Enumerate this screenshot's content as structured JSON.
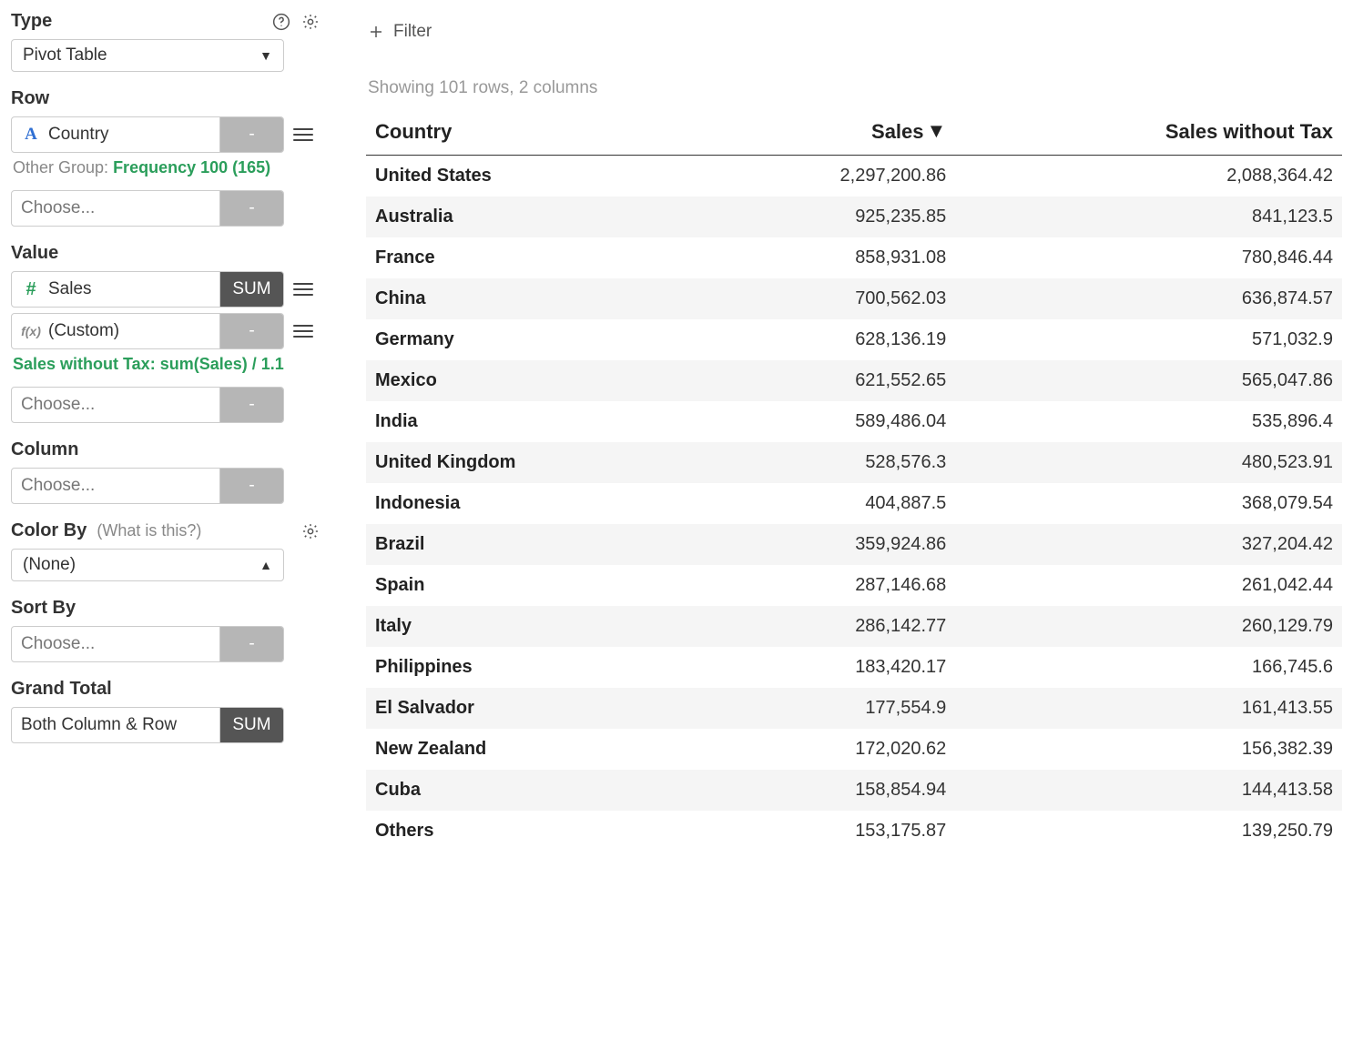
{
  "sidebar": {
    "type": {
      "label": "Type",
      "value": "Pivot Table"
    },
    "row": {
      "label": "Row",
      "field": "Country",
      "field_btn": "-",
      "subtext_grey": "Other Group:",
      "subtext_green": "Frequency 100 (165)",
      "choose": "Choose...",
      "choose_btn": "-"
    },
    "value": {
      "label": "Value",
      "field1": "Sales",
      "field1_btn": "SUM",
      "field2": "(Custom)",
      "field2_btn": "-",
      "formula": "Sales without Tax: sum(Sales) / 1.1",
      "choose": "Choose...",
      "choose_btn": "-"
    },
    "column": {
      "label": "Column",
      "choose": "Choose...",
      "choose_btn": "-"
    },
    "colorby": {
      "label": "Color By",
      "hint": "(What is this?)",
      "value": "(None)"
    },
    "sortby": {
      "label": "Sort By",
      "choose": "Choose...",
      "choose_btn": "-"
    },
    "grandtotal": {
      "label": "Grand Total",
      "value": "Both Column & Row",
      "btn": "SUM"
    }
  },
  "main": {
    "filter_label": "Filter",
    "status": "Showing 101 rows, 2 columns",
    "headers": {
      "country": "Country",
      "sales": "Sales",
      "sales_no_tax": "Sales without Tax"
    },
    "rows": [
      {
        "country": "United States",
        "sales": "2,297,200.86",
        "sales_no_tax": "2,088,364.42"
      },
      {
        "country": "Australia",
        "sales": "925,235.85",
        "sales_no_tax": "841,123.5"
      },
      {
        "country": "France",
        "sales": "858,931.08",
        "sales_no_tax": "780,846.44"
      },
      {
        "country": "China",
        "sales": "700,562.03",
        "sales_no_tax": "636,874.57"
      },
      {
        "country": "Germany",
        "sales": "628,136.19",
        "sales_no_tax": "571,032.9"
      },
      {
        "country": "Mexico",
        "sales": "621,552.65",
        "sales_no_tax": "565,047.86"
      },
      {
        "country": "India",
        "sales": "589,486.04",
        "sales_no_tax": "535,896.4"
      },
      {
        "country": "United Kingdom",
        "sales": "528,576.3",
        "sales_no_tax": "480,523.91"
      },
      {
        "country": "Indonesia",
        "sales": "404,887.5",
        "sales_no_tax": "368,079.54"
      },
      {
        "country": "Brazil",
        "sales": "359,924.86",
        "sales_no_tax": "327,204.42"
      },
      {
        "country": "Spain",
        "sales": "287,146.68",
        "sales_no_tax": "261,042.44"
      },
      {
        "country": "Italy",
        "sales": "286,142.77",
        "sales_no_tax": "260,129.79"
      },
      {
        "country": "Philippines",
        "sales": "183,420.17",
        "sales_no_tax": "166,745.6"
      },
      {
        "country": "El Salvador",
        "sales": "177,554.9",
        "sales_no_tax": "161,413.55"
      },
      {
        "country": "New Zealand",
        "sales": "172,020.62",
        "sales_no_tax": "156,382.39"
      },
      {
        "country": "Cuba",
        "sales": "158,854.94",
        "sales_no_tax": "144,413.58"
      },
      {
        "country": "Others",
        "sales": "153,175.87",
        "sales_no_tax": "139,250.79"
      }
    ]
  }
}
